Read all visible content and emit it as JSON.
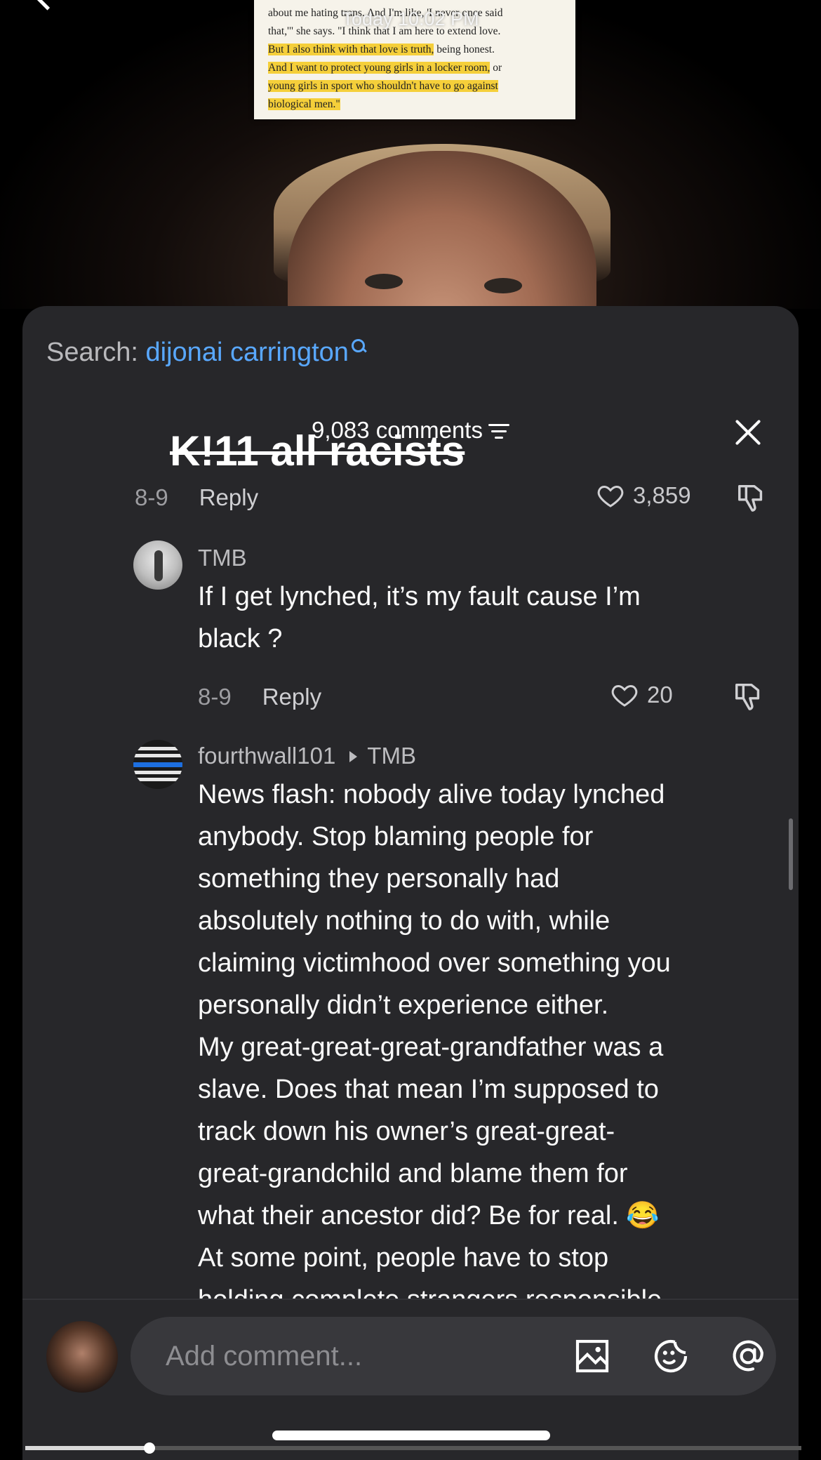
{
  "video": {
    "timestamp": "Today 10:02 PM",
    "doc_lines": [
      {
        "pre": "about me hating trans. And I'm like, 'I never once said",
        "hl": ""
      },
      {
        "pre": "that,'\" she says. \"I think that I am here to extend love.",
        "hl": ""
      },
      {
        "pre": "",
        "hl": "But I also think with that love is truth,",
        "post": " being honest."
      },
      {
        "pre": "",
        "hl": "And I want to protect young girls in a locker room,",
        "post": " or"
      },
      {
        "pre": "",
        "hl": "young girls in sport who shouldn't have to go against",
        "post": ""
      },
      {
        "pre": "",
        "hl": "biological men.\"",
        "post": ""
      }
    ],
    "progress": 0.16
  },
  "sheet": {
    "search_label": "Search:",
    "search_query": "dijonai carrington",
    "comment_count": "9,083 comments",
    "struck_text": "K!11 all racists"
  },
  "comments": [
    {
      "date": "8-9",
      "reply_label": "Reply",
      "likes": "3,859"
    },
    {
      "username": "TMB",
      "text_lines": [
        "If I get lynched, it’s my fault cause I’m",
        "black ?"
      ],
      "date": "8-9",
      "reply_label": "Reply",
      "likes": "20"
    },
    {
      "username": "fourthwall101",
      "reply_to": "TMB",
      "text_lines": [
        "News flash: nobody alive today lynched",
        "anybody. Stop blaming people for",
        "something they personally had",
        "absolutely nothing to do with, while",
        "claiming victimhood over something you",
        "personally didn’t experience either.",
        "My great-great-great-grandfather was a",
        "slave. Does that mean I’m supposed to",
        "track down his owner’s great-great-",
        "great-grandchild and blame them for",
        "what their ancestor did? Be for real. 😂",
        "At some point, people have to stop",
        "holding complete strangers responsible"
      ]
    }
  ],
  "input": {
    "placeholder": "Add comment..."
  },
  "colors": {
    "sheet_bg": "#27272a",
    "link_blue": "#59a8ff",
    "highlight": "#f5cf3a"
  },
  "icons": [
    "search-icon",
    "sort-icon",
    "close-icon",
    "heart-icon",
    "dislike-icon",
    "image-icon",
    "emoji-icon",
    "mention-icon"
  ]
}
